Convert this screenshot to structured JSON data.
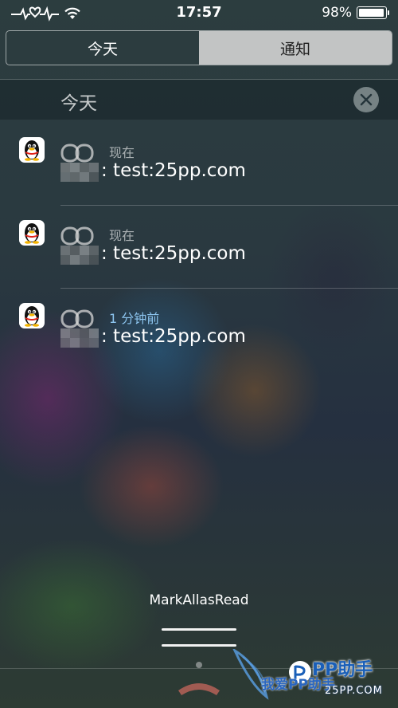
{
  "status_bar": {
    "time": "17:57",
    "battery_percent": "98%",
    "battery_level": 0.98,
    "icons": [
      "heartbeat-icon",
      "wifi-icon",
      "battery-icon"
    ]
  },
  "segmented_control": {
    "tabs": [
      {
        "label": "今天",
        "selected": true
      },
      {
        "label": "通知",
        "selected": false
      }
    ]
  },
  "section": {
    "title": "今天",
    "clear_icon": "close-icon"
  },
  "notifications": [
    {
      "app_icon": "qq-penguin-icon",
      "time": "现在",
      "message": ": test:25pp.com"
    },
    {
      "app_icon": "qq-penguin-icon",
      "time": "现在",
      "message": ": test:25pp.com"
    },
    {
      "app_icon": "qq-penguin-icon",
      "time": "1 分钟前",
      "message": ": test:25pp.com"
    }
  ],
  "footer": {
    "mark_all_label": "MarkAllasRead"
  },
  "watermark": {
    "brand": "PP助手",
    "chinese": "我爱PP助手",
    "url": "25PP.COM"
  },
  "colors": {
    "time_recent": "#8cc4ee",
    "segment_inactive_bg": "#d7d7d7"
  }
}
